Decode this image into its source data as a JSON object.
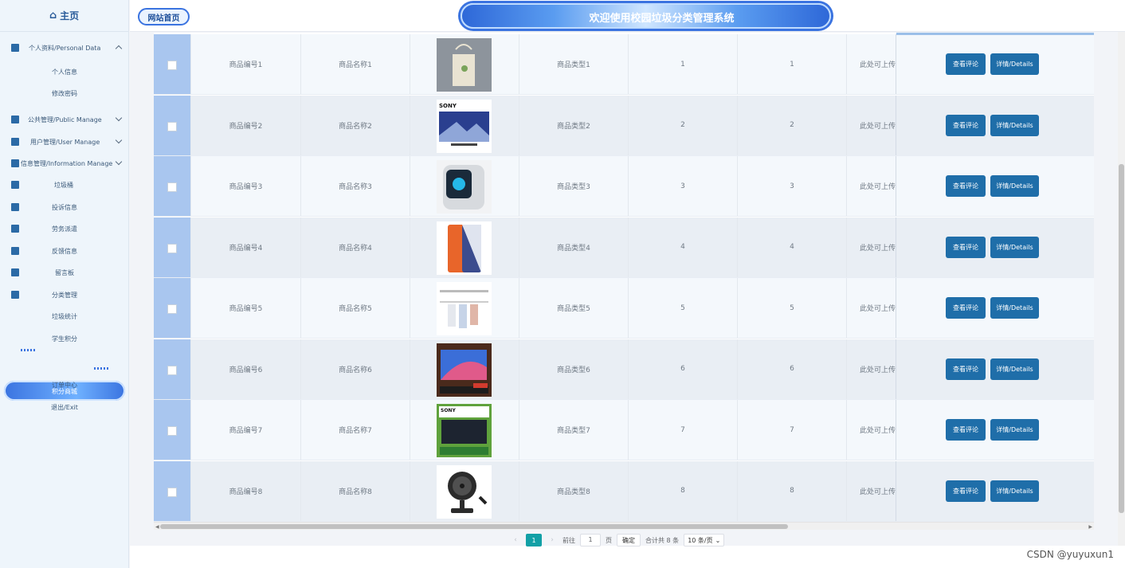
{
  "sidebar": {
    "home_label": "主页",
    "items": [
      {
        "label": "个人资料/Personal Data"
      },
      {
        "label": "个人信息"
      },
      {
        "label": "修改密码"
      },
      {
        "label": "公共管理/Public Manage"
      },
      {
        "label": "用户管理/User Manage"
      },
      {
        "label": "信息管理/Information Manage"
      },
      {
        "label": "垃圾桶"
      },
      {
        "label": "投诉信息"
      },
      {
        "label": "劳务派遣"
      },
      {
        "label": "反馈信息"
      },
      {
        "label": "留言板"
      },
      {
        "label": "分类管理"
      },
      {
        "label": "垃圾统计"
      },
      {
        "label": "学生积分"
      },
      {
        "label": "积分商城"
      },
      {
        "label": "订单中心"
      },
      {
        "label": "退出/Exit"
      }
    ]
  },
  "header": {
    "home_link": "网站首页",
    "title": "欢迎使用校园垃圾分类管理系统"
  },
  "table": {
    "rows": [
      {
        "code": "商品编号1",
        "name": "商品名称1",
        "type": "商品类型1",
        "c1": "1",
        "c2": "1",
        "note": "此处可上传",
        "image": "tote-bag"
      },
      {
        "code": "商品编号2",
        "name": "商品名称2",
        "type": "商品类型2",
        "c1": "2",
        "c2": "2",
        "note": "此处可上传",
        "image": "sony-tv"
      },
      {
        "code": "商品编号3",
        "name": "商品名称3",
        "type": "商品类型3",
        "c1": "3",
        "c2": "3",
        "note": "此处可上传",
        "image": "pc-tower"
      },
      {
        "code": "商品编号4",
        "name": "商品名称4",
        "type": "商品类型4",
        "c1": "4",
        "c2": "4",
        "note": "此处可上传",
        "image": "smartphone"
      },
      {
        "code": "商品编号5",
        "name": "商品名称5",
        "type": "商品类型5",
        "c1": "5",
        "c2": "5",
        "note": "此处可上传",
        "image": "drying-rack"
      },
      {
        "code": "商品编号6",
        "name": "商品名称6",
        "type": "商品类型6",
        "c1": "6",
        "c2": "6",
        "note": "此处可上传",
        "image": "monitor"
      },
      {
        "code": "商品编号7",
        "name": "商品名称7",
        "type": "商品类型7",
        "c1": "7",
        "c2": "7",
        "note": "此处可上传",
        "image": "sony-tv-box"
      },
      {
        "code": "商品编号8",
        "name": "商品名称8",
        "type": "商品类型8",
        "c1": "8",
        "c2": "8",
        "note": "此处可上传",
        "image": "desk-fan"
      }
    ],
    "review_label": "查看评论",
    "details_label": "详情/Details"
  },
  "pager": {
    "current_page": "1",
    "goto_label": "前往",
    "page_input": "1",
    "page_suffix": "页",
    "confirm_label": "确定",
    "total_label": "合计共 8 条",
    "page_size": "10 条/页"
  },
  "watermark": "CSDN @yuyuxun1"
}
